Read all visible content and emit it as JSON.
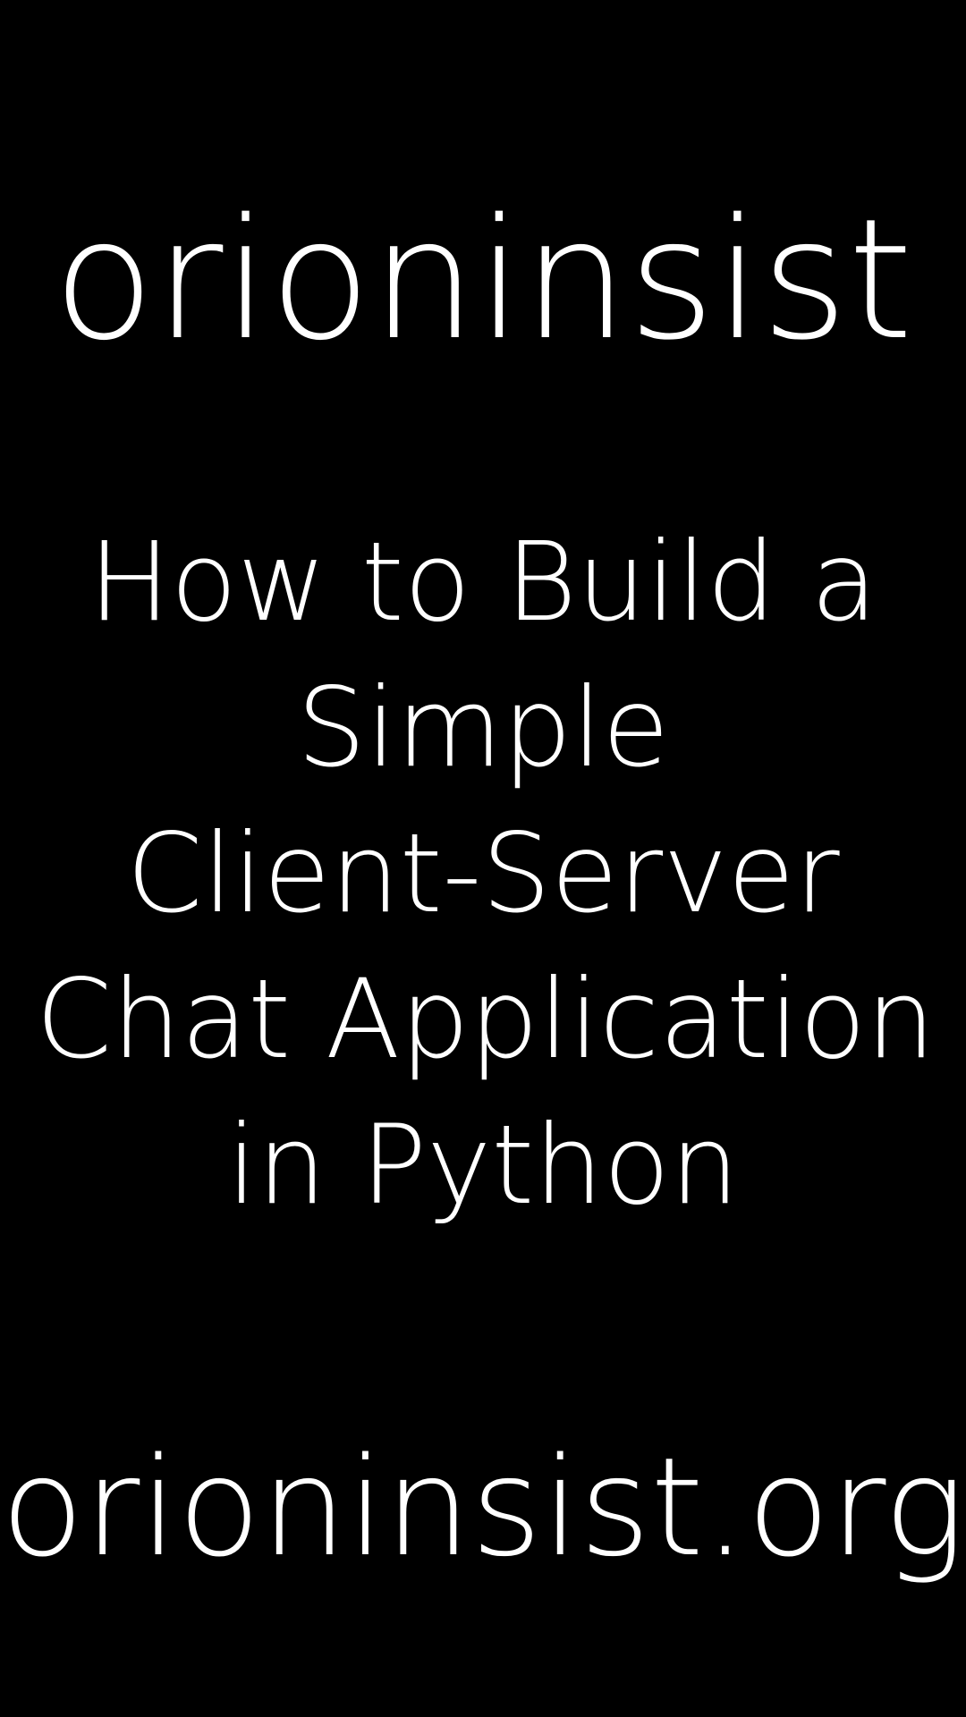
{
  "brand": "orioninsist",
  "title_lines": [
    "How to Build a",
    "Simple",
    "Client-Server",
    "Chat Application",
    "in Python"
  ],
  "url": "orioninsist.org",
  "colors": {
    "background": "#000000",
    "text": "#ffffff"
  }
}
